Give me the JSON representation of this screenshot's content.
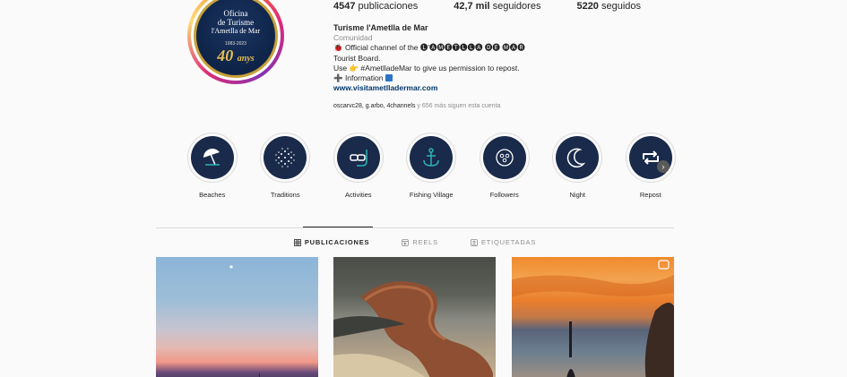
{
  "profile": {
    "avatar": {
      "line1": "Oficina",
      "line2": "de Turisme",
      "line3": "l'Ametlla de Mar",
      "years": "1983-2023",
      "anniversary": "40",
      "anniversary_word": "anys"
    },
    "stats": {
      "posts_count": "4547",
      "posts_label": "publicaciones",
      "followers_count": "42,7 mil",
      "followers_label": "seguidores",
      "following_count": "5220",
      "following_label": "seguidos"
    },
    "bio": {
      "name": "Turisme l'Ametlla de Mar",
      "category": "Comunidad",
      "line1": "🐞 Official channel of the 🅛'🅐🅜🅔🅣🅛🅛🅐 🅓🅔 🅜🅐🅡",
      "line2": "Tourist Board.",
      "line3": "Use 👉 #AmetlladeMar to give us permission to repost.",
      "line4": "➕ Information",
      "website": "www.visitametlladermar.com",
      "followed_by_names": "oscarvc28, g.arbo, 4channels",
      "followed_by_more": " y 656 más siguen esta cuenta"
    }
  },
  "highlights": [
    {
      "label": "Beaches",
      "icon": "umbrella-icon"
    },
    {
      "label": "Traditions",
      "icon": "dots-pattern-icon"
    },
    {
      "label": "Activities",
      "icon": "snorkel-icon"
    },
    {
      "label": "Fishing Village",
      "icon": "anchor-icon"
    },
    {
      "label": "Followers",
      "icon": "people-icon"
    },
    {
      "label": "Night",
      "icon": "moon-icon"
    },
    {
      "label": "Repost",
      "icon": "repost-icon"
    }
  ],
  "tabs": [
    {
      "label": "PUBLICACIONES",
      "icon": "grid-icon",
      "active": true
    },
    {
      "label": "REELS",
      "icon": "reels-icon",
      "active": false
    },
    {
      "label": "ETIQUETADAS",
      "icon": "tagged-icon",
      "active": false
    }
  ],
  "colors": {
    "accent_link": "#00376b",
    "highlight_bg": "#1a2a4a",
    "icon_teal": "#2ab3b8"
  }
}
